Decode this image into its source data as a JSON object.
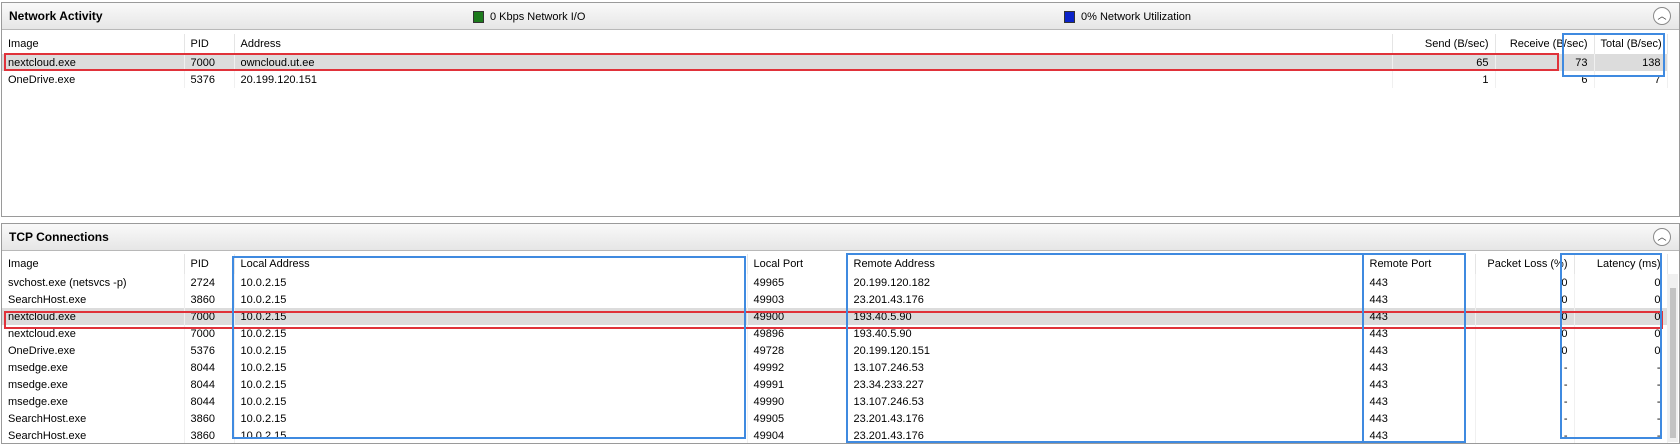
{
  "network": {
    "title": "Network Activity",
    "io_label": "0 Kbps Network I/O",
    "util_label": "0% Network Utilization",
    "io_color": "#1c7a1c",
    "util_color": "#0b23c9",
    "columns": {
      "image": "Image",
      "pid": "PID",
      "address": "Address",
      "send": "Send (B/sec)",
      "receive": "Receive (B/sec)",
      "total": "Total (B/sec)"
    },
    "rows": [
      {
        "image": "nextcloud.exe",
        "pid": "7000",
        "address": "owncloud.ut.ee",
        "send": "65",
        "receive": "73",
        "total": "138"
      },
      {
        "image": "OneDrive.exe",
        "pid": "5376",
        "address": "20.199.120.151",
        "send": "1",
        "receive": "6",
        "total": "7"
      }
    ]
  },
  "tcp": {
    "title": "TCP Connections",
    "columns": {
      "image": "Image",
      "pid": "PID",
      "local_address": "Local Address",
      "local_port": "Local Port",
      "remote_address": "Remote Address",
      "remote_port": "Remote Port",
      "packet_loss": "Packet Loss (%)",
      "latency": "Latency (ms)"
    },
    "rows": [
      {
        "image": "svchost.exe (netsvcs -p)",
        "pid": "2724",
        "local_address": "10.0.2.15",
        "local_port": "49965",
        "remote_address": "20.199.120.182",
        "remote_port": "443",
        "packet_loss": "0",
        "latency": "0"
      },
      {
        "image": "SearchHost.exe",
        "pid": "3860",
        "local_address": "10.0.2.15",
        "local_port": "49903",
        "remote_address": "23.201.43.176",
        "remote_port": "443",
        "packet_loss": "0",
        "latency": "0"
      },
      {
        "image": "nextcloud.exe",
        "pid": "7000",
        "local_address": "10.0.2.15",
        "local_port": "49900",
        "remote_address": "193.40.5.90",
        "remote_port": "443",
        "packet_loss": "0",
        "latency": "0"
      },
      {
        "image": "nextcloud.exe",
        "pid": "7000",
        "local_address": "10.0.2.15",
        "local_port": "49896",
        "remote_address": "193.40.5.90",
        "remote_port": "443",
        "packet_loss": "0",
        "latency": "0"
      },
      {
        "image": "OneDrive.exe",
        "pid": "5376",
        "local_address": "10.0.2.15",
        "local_port": "49728",
        "remote_address": "20.199.120.151",
        "remote_port": "443",
        "packet_loss": "0",
        "latency": "0"
      },
      {
        "image": "msedge.exe",
        "pid": "8044",
        "local_address": "10.0.2.15",
        "local_port": "49992",
        "remote_address": "13.107.246.53",
        "remote_port": "443",
        "packet_loss": "-",
        "latency": "-"
      },
      {
        "image": "msedge.exe",
        "pid": "8044",
        "local_address": "10.0.2.15",
        "local_port": "49991",
        "remote_address": "23.34.233.227",
        "remote_port": "443",
        "packet_loss": "-",
        "latency": "-"
      },
      {
        "image": "msedge.exe",
        "pid": "8044",
        "local_address": "10.0.2.15",
        "local_port": "49990",
        "remote_address": "13.107.246.53",
        "remote_port": "443",
        "packet_loss": "-",
        "latency": "-"
      },
      {
        "image": "SearchHost.exe",
        "pid": "3860",
        "local_address": "10.0.2.15",
        "local_port": "49905",
        "remote_address": "23.201.43.176",
        "remote_port": "443",
        "packet_loss": "-",
        "latency": "-"
      },
      {
        "image": "SearchHost.exe",
        "pid": "3860",
        "local_address": "10.0.2.15",
        "local_port": "49904",
        "remote_address": "23.201.43.176",
        "remote_port": "443",
        "packet_loss": "-",
        "latency": "-"
      }
    ]
  }
}
